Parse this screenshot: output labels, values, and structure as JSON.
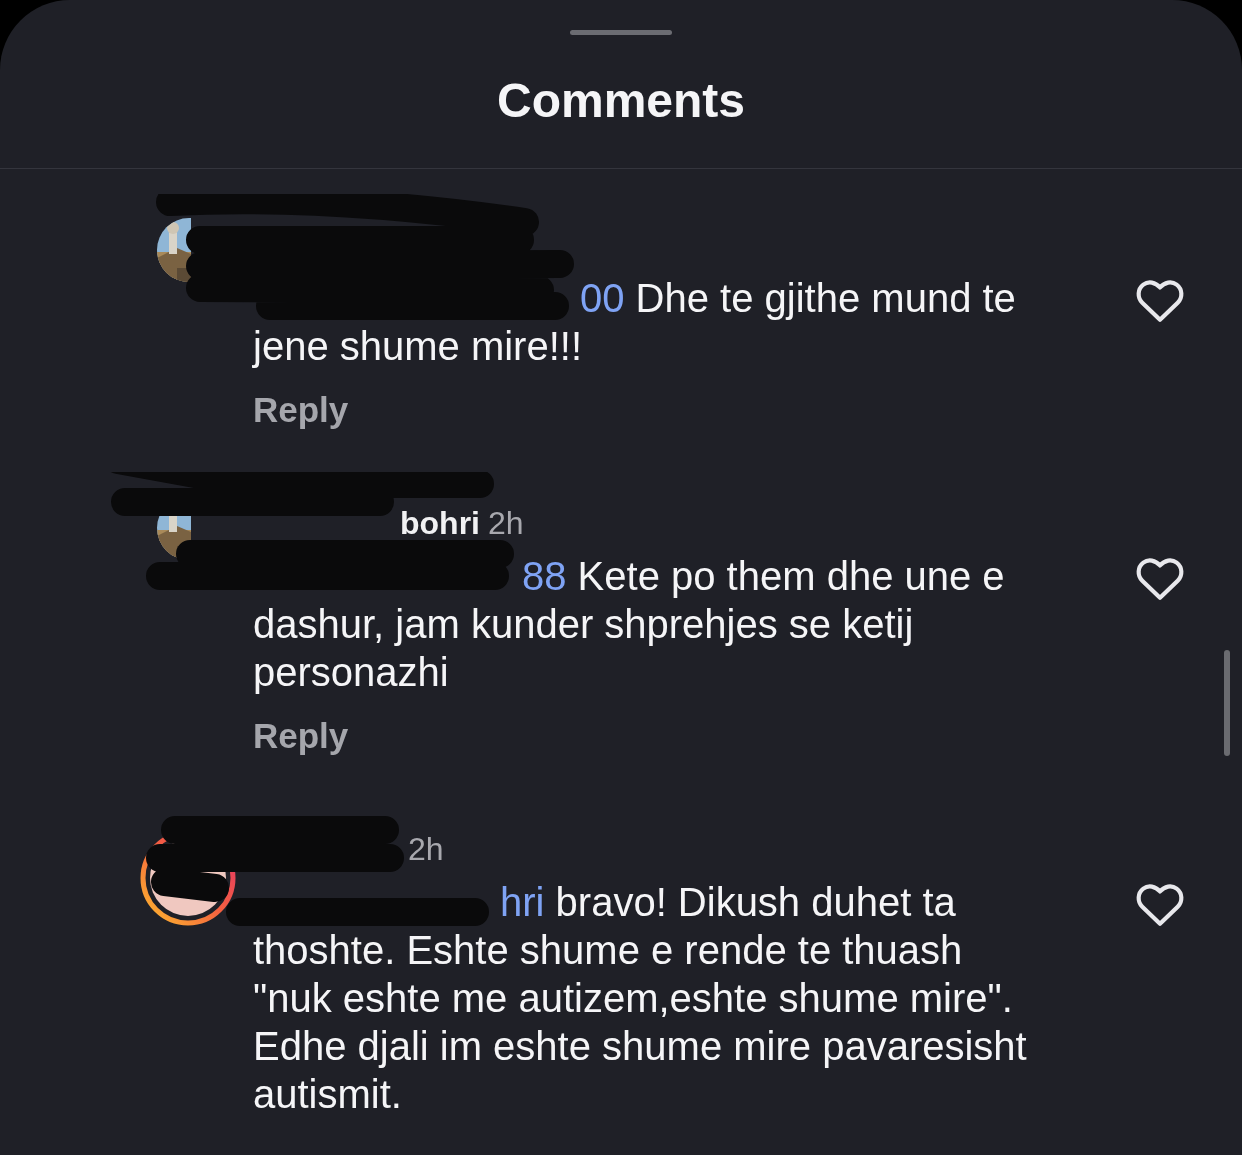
{
  "title": "Comments",
  "comments": [
    {
      "avatar": {
        "ring": false
      },
      "mention": "00",
      "text": "Dhe te gjithe mund te jene shume mire!!!",
      "reply": "Reply",
      "liked": false
    },
    {
      "avatar": {
        "ring": false
      },
      "name": "bohri",
      "time": "2h",
      "mention": "88",
      "text": "Kete po them dhe une e dashur, jam kunder shprehjes se ketij personazhi",
      "reply": "Reply",
      "liked": false
    },
    {
      "avatar": {
        "ring": true
      },
      "time": "2h",
      "mention": "hri",
      "text": "bravo! Dikush duhet ta thoshte. Eshte shume e rende te thuash \"nuk eshte me autizem,eshte shume mire\". Edhe djali im eshte shume mire pavaresisht autismit.",
      "liked": false
    }
  ]
}
